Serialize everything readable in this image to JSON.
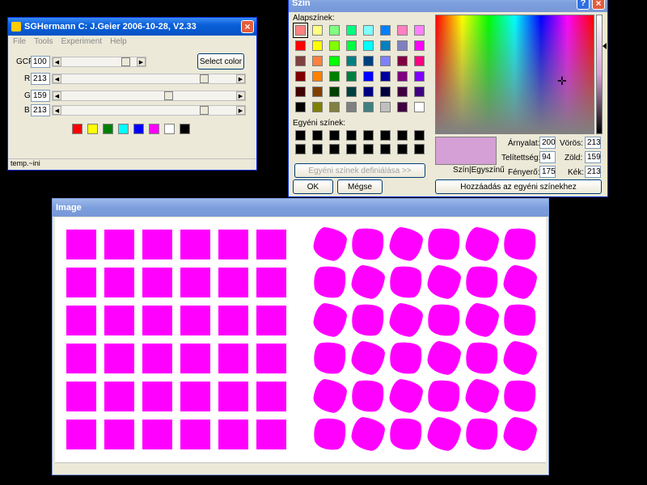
{
  "sgh": {
    "title": "SGHermann C: J.Geier 2006-10-28, V2.33",
    "menu": [
      "File",
      "Tools",
      "Experiment",
      "Help"
    ],
    "rows": [
      {
        "label": "GCF",
        "value": "100",
        "level": 0.9
      },
      {
        "label": "R",
        "value": "213",
        "level": 0.835
      },
      {
        "label": "G",
        "value": "159",
        "level": 0.62
      },
      {
        "label": "B",
        "value": "213",
        "level": 0.835
      }
    ],
    "select_color_label": "Select color",
    "swatches": [
      "#ff0000",
      "#ffff00",
      "#008000",
      "#00ffff",
      "#0000ff",
      "#ff00ff",
      "#ffffff",
      "#000000"
    ],
    "status": "temp.~ini"
  },
  "szin": {
    "title": "Szín",
    "basic_colors_label": "Alapszínek:",
    "basic_colors": [
      "#ff8080",
      "#ffff80",
      "#80ff80",
      "#00ff80",
      "#80ffff",
      "#0080ff",
      "#ff80c0",
      "#ff80ff",
      "#ff0000",
      "#ffff00",
      "#80ff00",
      "#00ff40",
      "#00ffff",
      "#0080c0",
      "#8080c0",
      "#ff00ff",
      "#804040",
      "#ff8040",
      "#00ff00",
      "#008080",
      "#004080",
      "#8080ff",
      "#800040",
      "#ff0080",
      "#800000",
      "#ff8000",
      "#008000",
      "#008040",
      "#0000ff",
      "#0000a0",
      "#800080",
      "#8000ff",
      "#400000",
      "#804000",
      "#004000",
      "#004040",
      "#000080",
      "#000040",
      "#400040",
      "#400080",
      "#000000",
      "#808000",
      "#808040",
      "#808080",
      "#408080",
      "#c0c0c0",
      "#400040",
      "#ffffff"
    ],
    "custom_colors_label": "Egyéni színek:",
    "define_custom_label": "Egyéni színek definiálása >>",
    "ok_label": "OK",
    "cancel_label": "Mégse",
    "preview_label": "Szín|Egyszínű",
    "hue_label": "Árnyalat:",
    "hue": "200",
    "sat_label": "Telítettség:",
    "sat": "94",
    "lum_label": "Fényerő:",
    "lum": "175",
    "red_label": "Vörös:",
    "red": "213",
    "green_label": "Zöld:",
    "green": "159",
    "blue_label": "Kék:",
    "blue": "213",
    "add_custom_label": "Hozzáadás az egyéni színekhez",
    "preview_color": "#d5a0d5",
    "help_icon": "?",
    "close_icon": "×"
  },
  "image": {
    "title": "Image",
    "fill_color": "#ff00ff"
  }
}
